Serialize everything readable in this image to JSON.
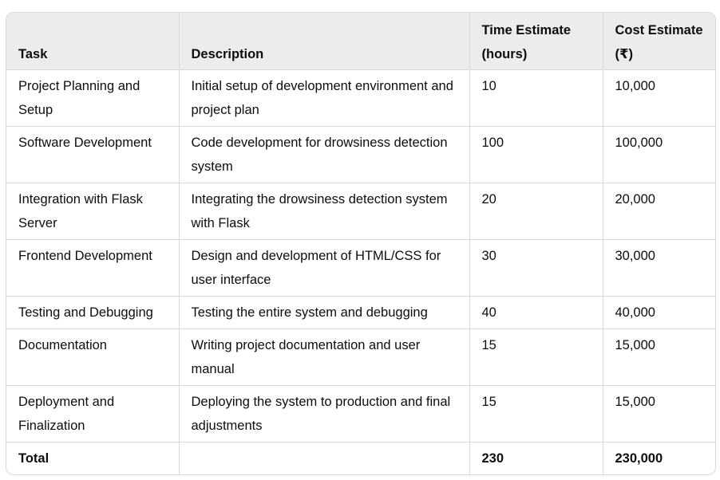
{
  "table": {
    "headers": [
      "Task",
      "Description",
      "Time Estimate (hours)",
      "Cost Estimate (₹)"
    ],
    "rows": [
      {
        "task": "Project Planning and Setup",
        "description": "Initial setup of development environment and project plan",
        "time": "10",
        "cost": "10,000"
      },
      {
        "task": "Software Development",
        "description": "Code development for drowsiness detection system",
        "time": "100",
        "cost": "100,000"
      },
      {
        "task": "Integration with Flask Server",
        "description": "Integrating the drowsiness detection system with Flask",
        "time": "20",
        "cost": "20,000"
      },
      {
        "task": "Frontend Development",
        "description": "Design and development of HTML/CSS for user interface",
        "time": "30",
        "cost": "30,000"
      },
      {
        "task": "Testing and Debugging",
        "description": "Testing the entire system and debugging",
        "time": "40",
        "cost": "40,000"
      },
      {
        "task": "Documentation",
        "description": "Writing project documentation and user manual",
        "time": "15",
        "cost": "15,000"
      },
      {
        "task": "Deployment and Finalization",
        "description": "Deploying the system to production and final adjustments",
        "time": "15",
        "cost": "15,000"
      }
    ],
    "total": {
      "task": "Total",
      "description": "",
      "time": "230",
      "cost": "230,000"
    }
  }
}
